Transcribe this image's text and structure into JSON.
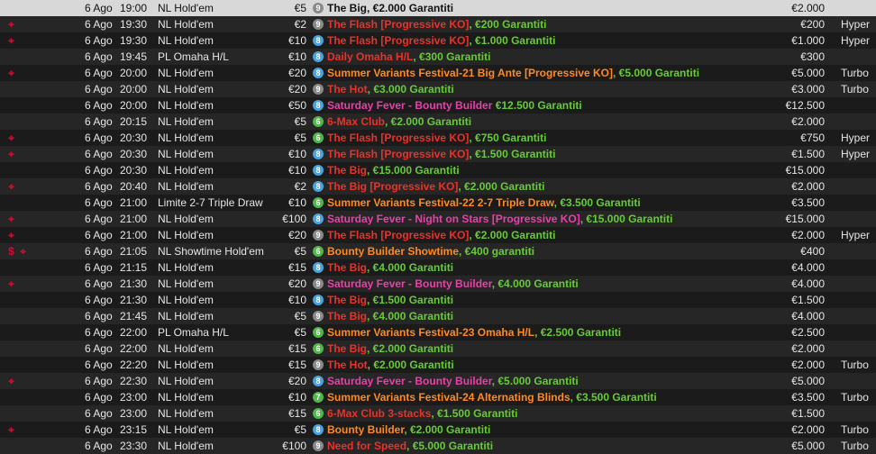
{
  "colors": {
    "accent_red": "#c8102e",
    "badge_gray": "#8a8a8a",
    "badge_blue": "#4aa3df",
    "badge_green": "#4fb848",
    "name_red": "#e8322a",
    "name_orange": "#ff8a1e",
    "name_pink": "#e840a8",
    "guarantee_green": "#66cc33"
  },
  "rows": [
    {
      "icons": [],
      "date": "6 Ago",
      "time": "19:00",
      "game": "NL Hold'em",
      "buyin": "€5",
      "badge": "9",
      "badge_color": "#8a8a8a",
      "name": "The Big",
      "name_color": "#111111",
      "guarantee": ", €2.000 Garantiti",
      "prize": "€2.000",
      "speed": ""
    },
    {
      "icons": [
        "target-icon"
      ],
      "date": "6 Ago",
      "time": "19:30",
      "game": "NL Hold'em",
      "buyin": "€2",
      "badge": "9",
      "badge_color": "#8a8a8a",
      "name": "The Flash [Progressive KO]",
      "name_color": "#e8322a",
      "guarantee": ", €200 Garantiti",
      "prize": "€200",
      "speed": "Hyper"
    },
    {
      "icons": [
        "target-icon"
      ],
      "date": "6 Ago",
      "time": "19:30",
      "game": "NL Hold'em",
      "buyin": "€10",
      "badge": "8",
      "badge_color": "#4aa3df",
      "name": "The Flash [Progressive KO]",
      "name_color": "#e8322a",
      "guarantee": ", €1.000 Garantiti",
      "prize": "€1.000",
      "speed": "Hyper"
    },
    {
      "icons": [],
      "date": "6 Ago",
      "time": "19:45",
      "game": "PL Omaha H/L",
      "buyin": "€10",
      "badge": "8",
      "badge_color": "#4aa3df",
      "name": "Daily Omaha H/L",
      "name_color": "#e8322a",
      "guarantee": ", €300 Garantiti",
      "prize": "€300",
      "speed": ""
    },
    {
      "icons": [
        "target-icon"
      ],
      "date": "6 Ago",
      "time": "20:00",
      "game": "NL Hold'em",
      "buyin": "€20",
      "badge": "8",
      "badge_color": "#4aa3df",
      "name": "Summer Variants Festival-21 Big Ante [Progressive KO]",
      "name_color": "#ff8a1e",
      "guarantee": ", €5.000 Garantiti",
      "prize": "€5.000",
      "speed": "Turbo"
    },
    {
      "icons": [],
      "date": "6 Ago",
      "time": "20:00",
      "game": "NL Hold'em",
      "buyin": "€20",
      "badge": "9",
      "badge_color": "#8a8a8a",
      "name": "The Hot",
      "name_color": "#e8322a",
      "guarantee": ", €3.000 Garantiti",
      "prize": "€3.000",
      "speed": "Turbo"
    },
    {
      "icons": [],
      "date": "6 Ago",
      "time": "20:00",
      "game": "NL Hold'em",
      "buyin": "€50",
      "badge": "8",
      "badge_color": "#4aa3df",
      "name": "Saturday Fever - Bounty Builder",
      "name_color": "#e840a8",
      "guarantee": " €12.500 Garantiti",
      "prize": "€12.500",
      "speed": ""
    },
    {
      "icons": [],
      "date": "6 Ago",
      "time": "20:15",
      "game": "NL Hold'em",
      "buyin": "€5",
      "badge": "6",
      "badge_color": "#4fb848",
      "name": "6-Max Club",
      "name_color": "#e8322a",
      "guarantee": ", €2.000 Garantiti",
      "prize": "€2.000",
      "speed": ""
    },
    {
      "icons": [
        "target-icon"
      ],
      "date": "6 Ago",
      "time": "20:30",
      "game": "NL Hold'em",
      "buyin": "€5",
      "badge": "6",
      "badge_color": "#4fb848",
      "name": "The Flash [Progressive KO]",
      "name_color": "#e8322a",
      "guarantee": ", €750 Garantiti",
      "prize": "€750",
      "speed": "Hyper"
    },
    {
      "icons": [
        "target-icon"
      ],
      "date": "6 Ago",
      "time": "20:30",
      "game": "NL Hold'em",
      "buyin": "€10",
      "badge": "8",
      "badge_color": "#4aa3df",
      "name": "The Flash [Progressive KO]",
      "name_color": "#e8322a",
      "guarantee": ", €1.500 Garantiti",
      "prize": "€1.500",
      "speed": "Hyper"
    },
    {
      "icons": [],
      "date": "6 Ago",
      "time": "20:30",
      "game": "NL Hold'em",
      "buyin": "€10",
      "badge": "8",
      "badge_color": "#4aa3df",
      "name": "The Big",
      "name_color": "#e8322a",
      "guarantee": ", €15.000 Garantiti",
      "prize": "€15.000",
      "speed": ""
    },
    {
      "icons": [
        "target-icon"
      ],
      "date": "6 Ago",
      "time": "20:40",
      "game": "NL Hold'em",
      "buyin": "€2",
      "badge": "8",
      "badge_color": "#4aa3df",
      "name": "The Big [Progressive KO]",
      "name_color": "#e8322a",
      "guarantee": ", €2.000 Garantiti",
      "prize": "€2.000",
      "speed": ""
    },
    {
      "icons": [],
      "date": "6 Ago",
      "time": "21:00",
      "game": "Limite 2-7 Triple Draw",
      "buyin": "€10",
      "badge": "6",
      "badge_color": "#4fb848",
      "name": "Summer Variants Festival-22 2-7 Triple Draw",
      "name_color": "#ff8a1e",
      "guarantee": ", €3.500 Garantiti",
      "prize": "€3.500",
      "speed": ""
    },
    {
      "icons": [
        "target-icon"
      ],
      "date": "6 Ago",
      "time": "21:00",
      "game": "NL Hold'em",
      "buyin": "€100",
      "badge": "8",
      "badge_color": "#4aa3df",
      "name": "Saturday Fever - Night on Stars [Progressive KO]",
      "name_color": "#e840a8",
      "guarantee": ", €15.000 Garantiti",
      "prize": "€15.000",
      "speed": ""
    },
    {
      "icons": [
        "target-icon"
      ],
      "date": "6 Ago",
      "time": "21:00",
      "game": "NL Hold'em",
      "buyin": "€20",
      "badge": "9",
      "badge_color": "#8a8a8a",
      "name": "The Flash [Progressive KO]",
      "name_color": "#e8322a",
      "guarantee": ", €2.000 Garantiti",
      "prize": "€2.000",
      "speed": "Hyper"
    },
    {
      "icons": [
        "dollar-icon",
        "target-icon"
      ],
      "date": "6 Ago",
      "time": "21:05",
      "game": "NL Showtime Hold'em",
      "buyin": "€5",
      "badge": "6",
      "badge_color": "#4fb848",
      "name": "Bounty Builder Showtime",
      "name_color": "#ff8a1e",
      "guarantee": ", €400 garantiti",
      "prize": "€400",
      "speed": ""
    },
    {
      "icons": [],
      "date": "6 Ago",
      "time": "21:15",
      "game": "NL Hold'em",
      "buyin": "€15",
      "badge": "8",
      "badge_color": "#4aa3df",
      "name": "The Big",
      "name_color": "#e8322a",
      "guarantee": ", €4.000 Garantiti",
      "prize": "€4.000",
      "speed": ""
    },
    {
      "icons": [
        "target-icon"
      ],
      "date": "6 Ago",
      "time": "21:30",
      "game": "NL Hold'em",
      "buyin": "€20",
      "badge": "9",
      "badge_color": "#8a8a8a",
      "name": "Saturday Fever - Bounty Builder",
      "name_color": "#e840a8",
      "guarantee": ", €4.000 Garantiti",
      "prize": "€4.000",
      "speed": ""
    },
    {
      "icons": [],
      "date": "6 Ago",
      "time": "21:30",
      "game": "NL Hold'em",
      "buyin": "€10",
      "badge": "8",
      "badge_color": "#4aa3df",
      "name": "The Big",
      "name_color": "#e8322a",
      "guarantee": ", €1.500 Garantiti",
      "prize": "€1.500",
      "speed": ""
    },
    {
      "icons": [],
      "date": "6 Ago",
      "time": "21:45",
      "game": "NL Hold'em",
      "buyin": "€5",
      "badge": "9",
      "badge_color": "#8a8a8a",
      "name": "The Big",
      "name_color": "#e8322a",
      "guarantee": ", €4.000 Garantiti",
      "prize": "€4.000",
      "speed": ""
    },
    {
      "icons": [],
      "date": "6 Ago",
      "time": "22:00",
      "game": "PL Omaha H/L",
      "buyin": "€5",
      "badge": "6",
      "badge_color": "#4fb848",
      "name": "Summer Variants Festival-23 Omaha H/L",
      "name_color": "#ff8a1e",
      "guarantee": ", €2.500 Garantiti",
      "prize": "€2.500",
      "speed": ""
    },
    {
      "icons": [],
      "date": "6 Ago",
      "time": "22:00",
      "game": "NL Hold'em",
      "buyin": "€15",
      "badge": "6",
      "badge_color": "#4fb848",
      "name": "The Big",
      "name_color": "#e8322a",
      "guarantee": ", €2.000 Garantiti",
      "prize": "€2.000",
      "speed": ""
    },
    {
      "icons": [],
      "date": "6 Ago",
      "time": "22:20",
      "game": "NL Hold'em",
      "buyin": "€15",
      "badge": "9",
      "badge_color": "#8a8a8a",
      "name": "The Hot",
      "name_color": "#e8322a",
      "guarantee": ", €2.000 Garantiti",
      "prize": "€2.000",
      "speed": "Turbo"
    },
    {
      "icons": [
        "target-icon"
      ],
      "date": "6 Ago",
      "time": "22:30",
      "game": "NL Hold'em",
      "buyin": "€20",
      "badge": "8",
      "badge_color": "#4aa3df",
      "name": "Saturday Fever - Bounty Builder",
      "name_color": "#e840a8",
      "guarantee": ", €5.000 Garantiti",
      "prize": "€5.000",
      "speed": ""
    },
    {
      "icons": [],
      "date": "6 Ago",
      "time": "23:00",
      "game": "NL Hold'em",
      "buyin": "€10",
      "badge": "7",
      "badge_color": "#4fb848",
      "name": "Summer Variants Festival-24 Alternating Blinds",
      "name_color": "#ff8a1e",
      "guarantee": ", €3.500 Garantiti",
      "prize": "€3.500",
      "speed": "Turbo"
    },
    {
      "icons": [],
      "date": "6 Ago",
      "time": "23:00",
      "game": "NL Hold'em",
      "buyin": "€15",
      "badge": "6",
      "badge_color": "#4fb848",
      "name": "6-Max Club 3-stacks",
      "name_color": "#e8322a",
      "guarantee": ", €1.500 Garantiti",
      "prize": "€1.500",
      "speed": ""
    },
    {
      "icons": [
        "target-icon"
      ],
      "date": "6 Ago",
      "time": "23:15",
      "game": "NL Hold'em",
      "buyin": "€5",
      "badge": "8",
      "badge_color": "#4aa3df",
      "name": "Bounty Builder",
      "name_color": "#ff8a1e",
      "guarantee": ", €2.000 Garantiti",
      "prize": "€2.000",
      "speed": "Turbo"
    },
    {
      "icons": [],
      "date": "6 Ago",
      "time": "23:30",
      "game": "NL Hold'em",
      "buyin": "€100",
      "badge": "9",
      "badge_color": "#8a8a8a",
      "name": "Need for Speed",
      "name_color": "#e8322a",
      "guarantee": ", €5.000 Garantiti",
      "prize": "€5.000",
      "speed": "Turbo"
    }
  ]
}
